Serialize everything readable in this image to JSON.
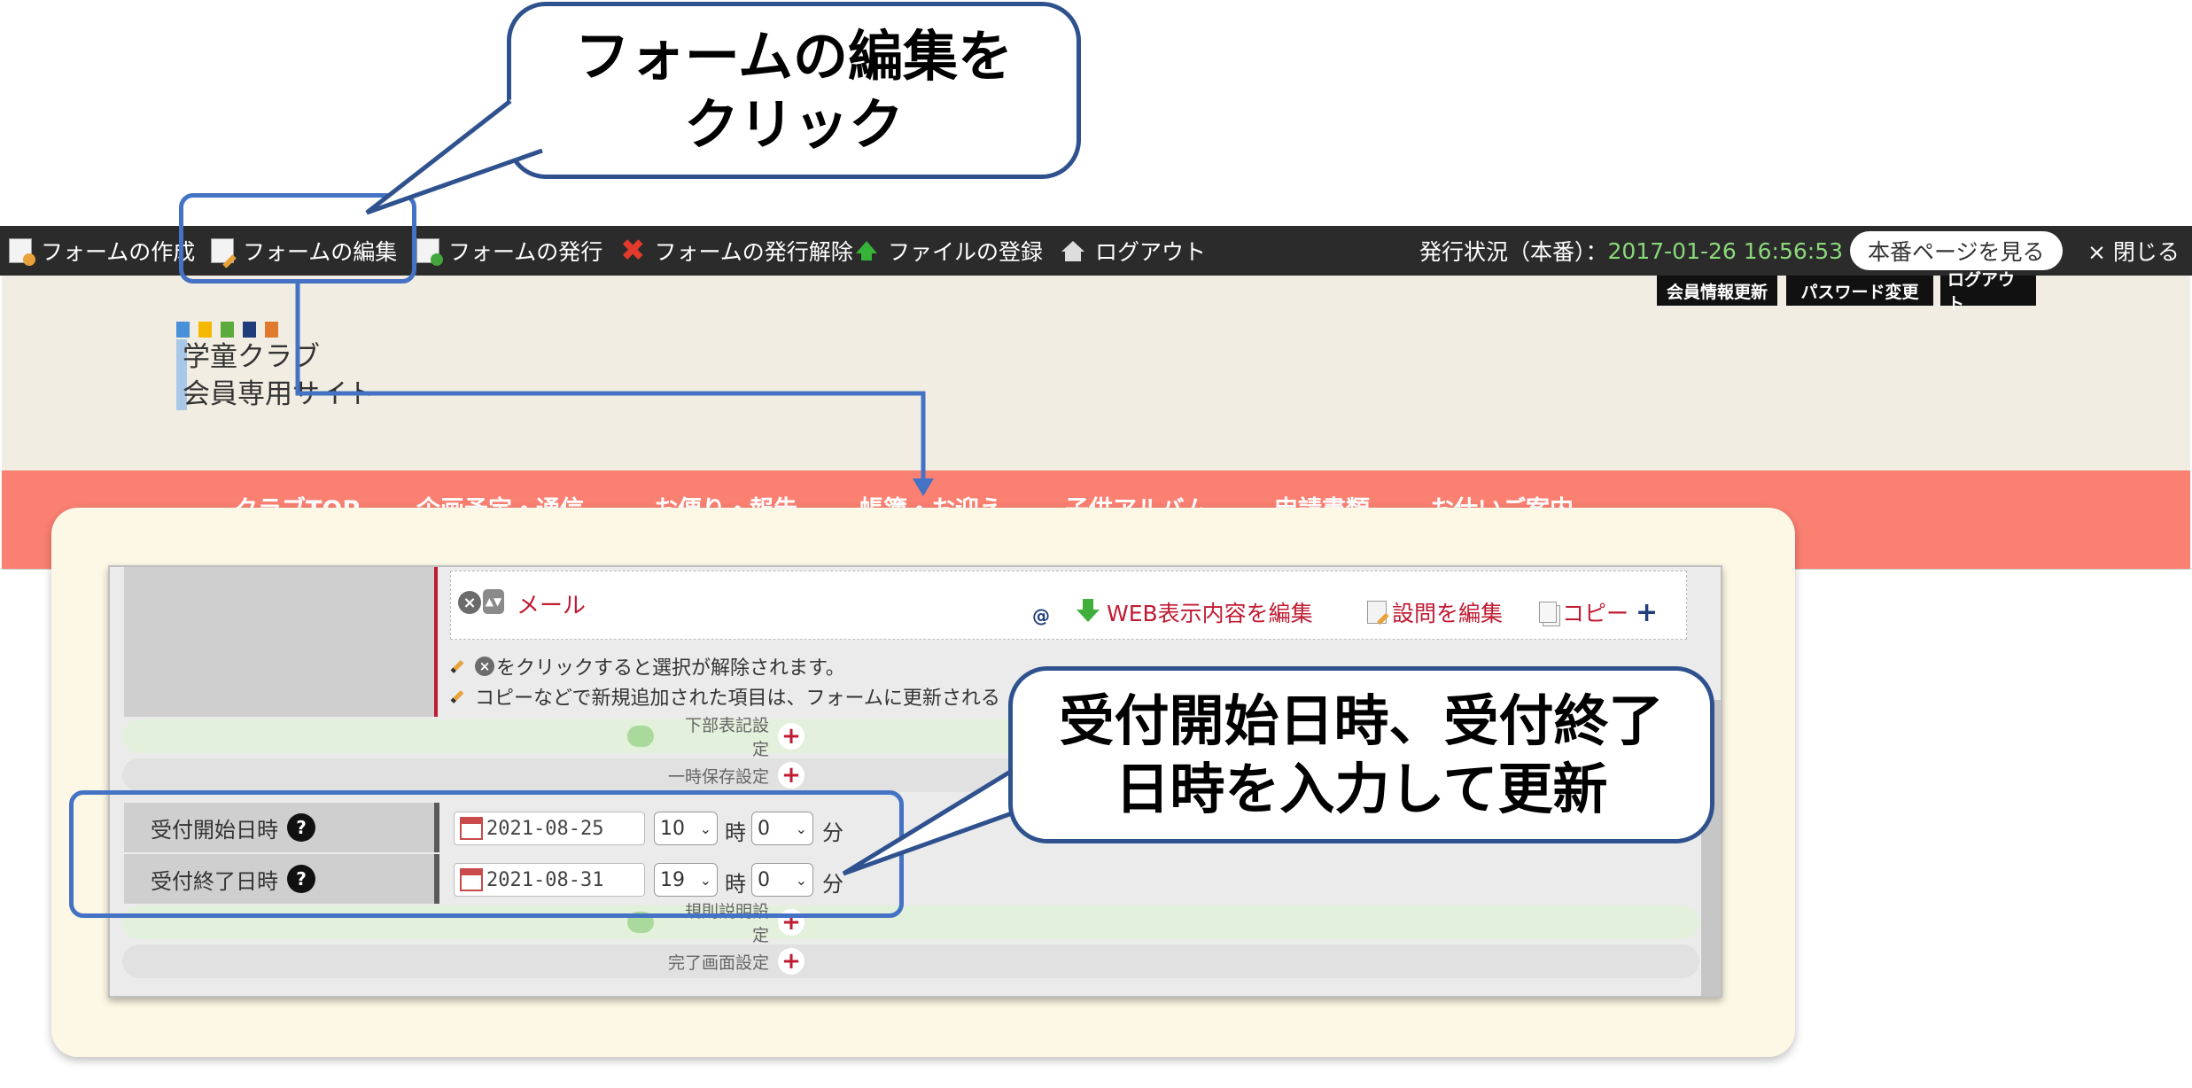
{
  "callouts": {
    "top": {
      "line1": "フォームの編集を",
      "line2": "クリック"
    },
    "right": {
      "line1": "受付開始日時、受付終了",
      "line2": "日時を入力して更新"
    }
  },
  "toolbar": {
    "create": "フォームの作成",
    "edit": "フォームの編集",
    "publish": "フォームの発行",
    "unpublish": "フォームの発行解除",
    "file_register": "ファイルの登録",
    "logout": "ログアウト",
    "status_label": "発行状況（本番）：",
    "status_date": "2017-01-26 16:56:53",
    "view_live": "本番ページを見る",
    "close": "× 閉じる"
  },
  "site_header": {
    "buttons": [
      "会員情報更新",
      "パスワード変更",
      "ログアウト"
    ],
    "logo_line1": "学童クラブ",
    "logo_line2": "会員専用サイト",
    "logo_colors": [
      "#4a90d9",
      "#f5b800",
      "#5aaa3c",
      "#1f3d7a",
      "#e07a2e"
    ],
    "nav": [
      "クラブTOP",
      "企画予定・通信",
      "お便り・報告",
      "帳簿・お迎え",
      "子供アルバム",
      "申請書類",
      "お仕いご案内"
    ]
  },
  "form": {
    "field_email": "メール",
    "at_icon": "@",
    "link_web_edit": "WEB表示内容を編集",
    "link_question_edit": "設問を編集",
    "link_copy": "コピー",
    "copy_plus": "+",
    "note1": "をクリックすると選択が解除されます。",
    "note2": "コピーなどで新規追加された項目は、フォームに更新される",
    "sections": {
      "footer": "下部表記設定",
      "temp_save": "一時保存設定",
      "rules": "規則説明設定",
      "complete": "完了画面設定"
    },
    "start": {
      "label": "受付開始日時",
      "date": "2021-08-25",
      "hour": "10",
      "minute": "0"
    },
    "end": {
      "label": "受付終了日時",
      "date": "2021-08-31",
      "hour": "19",
      "minute": "0"
    },
    "hour_unit": "時",
    "minute_unit": "分",
    "help": "?"
  },
  "colors": {
    "accent": "#4472c4",
    "callout_border": "#2f528f",
    "nav_bg": "#fa8072",
    "brand_red": "#c01b33"
  }
}
